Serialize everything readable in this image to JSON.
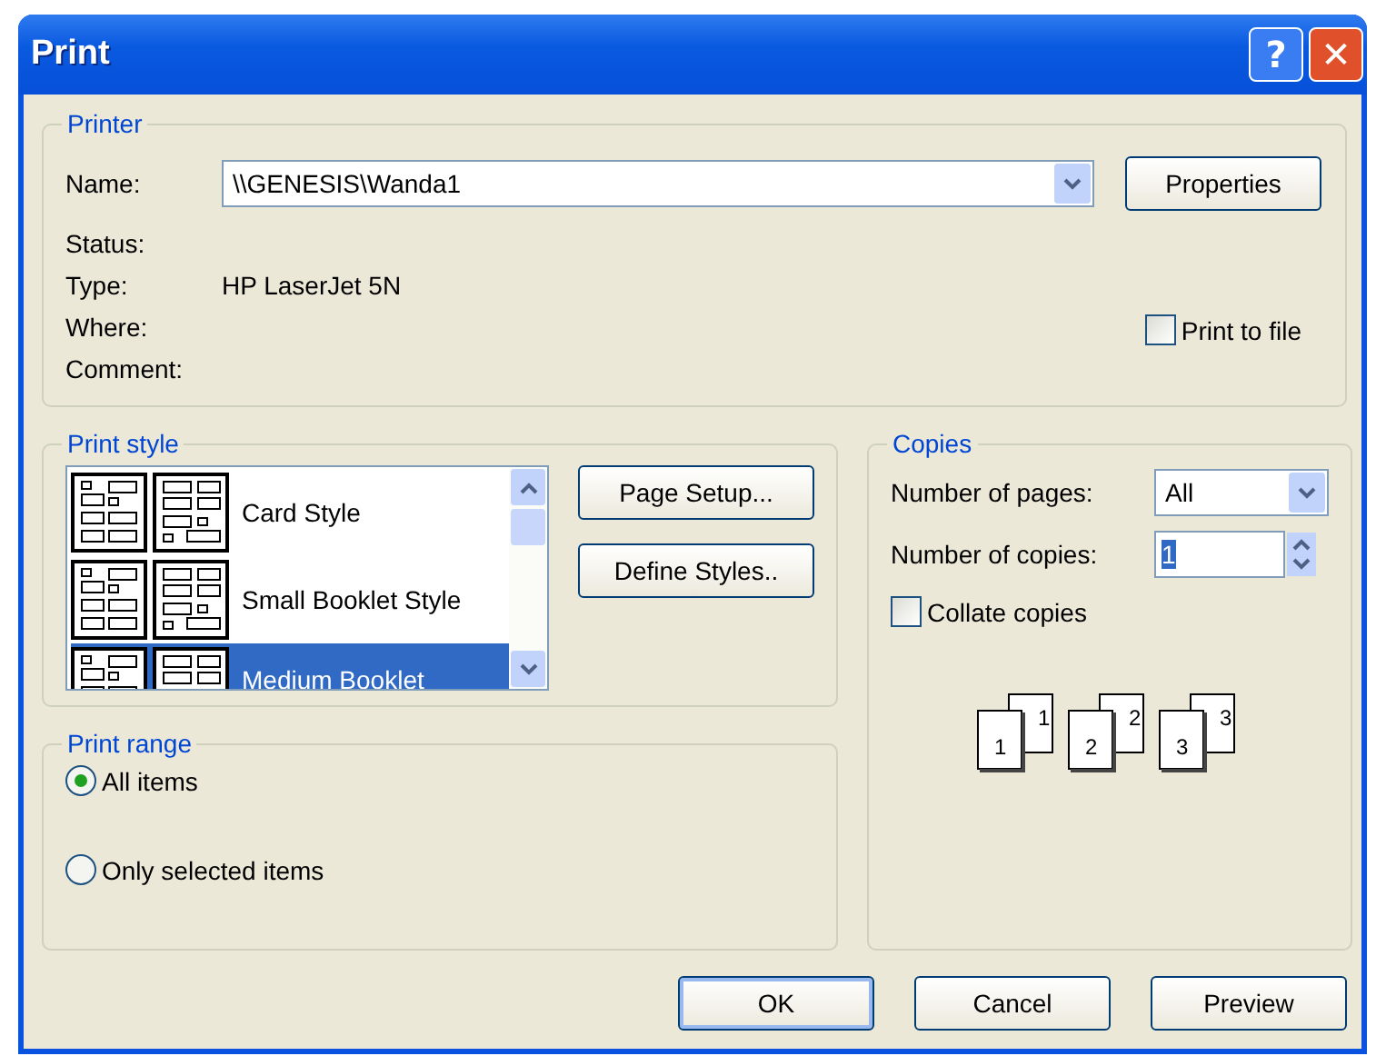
{
  "window": {
    "title": "Print"
  },
  "title_buttons": [
    {
      "kind": "help",
      "label": "?"
    },
    {
      "kind": "close",
      "label": "✕"
    }
  ],
  "printer": {
    "legend": "Printer",
    "name_label": "Name:",
    "name_value": "\\\\GENESIS\\Wanda1",
    "properties_button": "Properties",
    "info": [
      {
        "label": "Status:"
      },
      {
        "label": "Type:",
        "value": "HP LaserJet 5N"
      },
      {
        "label": "Where:"
      },
      {
        "label": "Comment:"
      }
    ],
    "print_to_file": {
      "label": "Print to file",
      "checked": false
    }
  },
  "print_style": {
    "legend": "Print style",
    "items": [
      {
        "label": "Card Style",
        "selected": false
      },
      {
        "label": "Small Booklet Style",
        "selected": false
      },
      {
        "label": "Medium Booklet",
        "selected": true
      }
    ],
    "buttons": [
      "Page Setup...",
      "Define Styles.."
    ]
  },
  "print_range": {
    "legend": "Print range",
    "options": [
      {
        "label": "All items",
        "selected": true
      },
      {
        "label": "Only selected items",
        "selected": false
      }
    ]
  },
  "copies": {
    "legend": "Copies",
    "pages_label": "Number of pages:",
    "pages_value": "All",
    "copies_label": "Number of copies:",
    "copies_value": "1",
    "collate": {
      "label": "Collate copies",
      "checked": false
    },
    "collate_illustration": [
      {
        "front": "1",
        "back": "1"
      },
      {
        "front": "2",
        "back": "2"
      },
      {
        "front": "3",
        "back": "3"
      }
    ]
  },
  "buttons": [
    {
      "label": "OK",
      "default": true
    },
    {
      "label": "Cancel",
      "default": false
    },
    {
      "label": "Preview",
      "default": false
    }
  ]
}
